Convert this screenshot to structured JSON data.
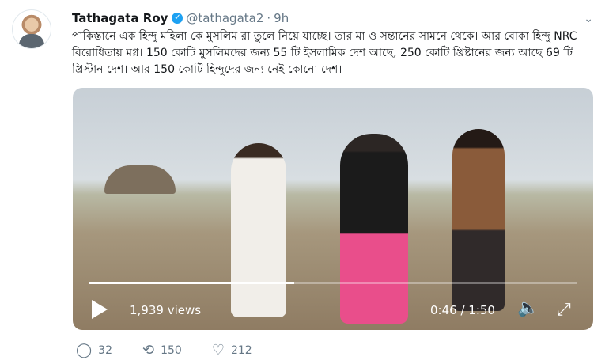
{
  "tweet": {
    "author_name": "Tathagata Roy",
    "handle": "@tathagata2",
    "time": "9h",
    "text": "পাকিস্তানে এক হিন্দু মহিলা কে মুসলিম রা তুলে নিয়ে যাচ্ছে। তার মা ও সন্তানের সামনে থেকে। আর বোকা হিন্দু NRC বিরোধিতায় মগ্ন। 150 কোটি মুসলিমদের জন্য 55 টি ইসলামিক দেশ আছে, 250 কোটি খ্রিষ্টানের জন্য আছে 69 টি খ্রিস্টান দেশ। আর 150 কোটি হিন্দুদের জন্য নেই কোনো দেশ।"
  },
  "video": {
    "views": "1,939 views",
    "time_display": "0:46 / 1:50",
    "progress": 0.42
  },
  "actions": {
    "replies": "32",
    "retweets": "150",
    "likes": "212"
  },
  "icons": {
    "verified": "verified-badge-icon",
    "menu": "chevron-down-icon",
    "play": "play-icon",
    "volume": "volume-icon",
    "fullscreen": "fullscreen-icon",
    "reply": "reply-icon",
    "retweet": "retweet-icon",
    "like": "heart-icon"
  },
  "colors": {
    "verified": "#1da1f2",
    "muted_text": "#657786"
  }
}
